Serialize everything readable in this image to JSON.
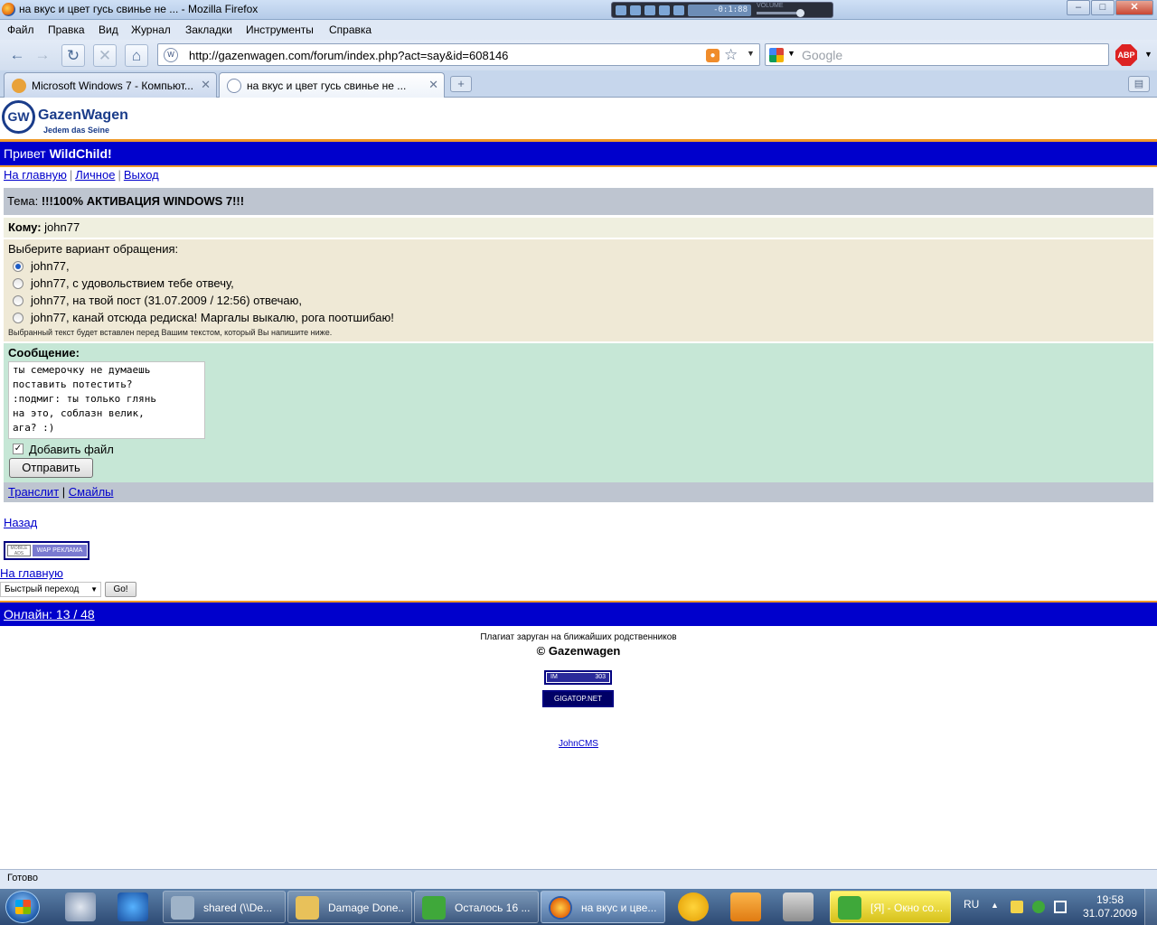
{
  "window": {
    "title": "на вкус и цвет гусь свинье не ... - Mozilla Firefox",
    "media_display": "-0:1:88",
    "media_volume_label": "VOLUME",
    "controls": {
      "minimize": "–",
      "maximize": "□",
      "close": "✕"
    }
  },
  "menu": [
    "Файл",
    "Правка",
    "Вид",
    "Журнал",
    "Закладки",
    "Инструменты",
    "Справка"
  ],
  "nav": {
    "url": "http://gazenwagen.com/forum/index.php?act=say&id=608146",
    "search_placeholder": "Google",
    "abp_label": "ABP"
  },
  "tabs": [
    {
      "label": "Microsoft Windows 7 - Компьют...",
      "active": false
    },
    {
      "label": "на вкус и цвет гусь свинье не ...",
      "active": true
    }
  ],
  "site": {
    "logo_name": "GazenWagen",
    "logo_slogan": "Jedem das Seine",
    "greeting_prefix": "Привет ",
    "greeting_user": "WildChild!",
    "links": {
      "home": "На главную",
      "personal": "Личное",
      "logout": "Выход"
    },
    "topic_prefix": "Тема: ",
    "topic_title": "!!!100% АКТИВАЦИЯ WINDOWS 7!!!",
    "to_label": "Кому:",
    "to_value": " john77",
    "choose_label": "Выберите вариант обращения:",
    "options": [
      {
        "text": "john77,",
        "selected": true
      },
      {
        "text": "john77, с удовольствием тебе отвечу,",
        "selected": false
      },
      {
        "text": "john77, на твой пост (31.07.2009 / 12:56) отвечаю,",
        "selected": false
      },
      {
        "text": "john77, канай отсюда редиска! Маргалы выкалю, рога поотшибаю!",
        "selected": false
      }
    ],
    "options_note": "Выбранный текст будет вставлен перед Вашим текстом, который Вы напишите ниже.",
    "message_label": "Сообщение:",
    "message_text": "ты семерочку не думаешь\nпоставить потестить?\n:подмиг: ты только глянь\nна это, соблазн велик,\nага? :)",
    "attach_label": "Добавить файл",
    "attach_checked": true,
    "send_label": "Отправить",
    "translit": "Транслит",
    "smiles": "Смайлы",
    "back": "Назад",
    "banner_left": "MOBILE ADS",
    "banner_right": "WAP РЕКЛАМА",
    "home2": "На главную",
    "quick_select": "Быстрый переход",
    "go_label": "Go!",
    "online": "Онлайн: 13 / 48",
    "footer_note": "Плагиат заруган на ближайших родственников",
    "copyright": "© Gazenwagen",
    "counter1_left": "IM",
    "counter1_right": "303",
    "counter2": "GIGATOP.NET",
    "johncms": "JohnCMS"
  },
  "status": "Готово",
  "taskbar": {
    "buttons": [
      {
        "label": "shared (\\\\De...",
        "active": false,
        "color": "#9fb3c8"
      },
      {
        "label": "Damage Done...",
        "active": false,
        "color": "#e8c15a"
      },
      {
        "label": "Осталось 16 ...",
        "active": false,
        "color": "#3fa83a"
      },
      {
        "label": "на вкус и цве...",
        "active": true,
        "color": "#e4670c"
      },
      {
        "label": "[Я] - Окно со...",
        "active": false,
        "color": "#3fa83a"
      }
    ],
    "lang": "RU",
    "time": "19:58",
    "date": "31.07.2009"
  }
}
